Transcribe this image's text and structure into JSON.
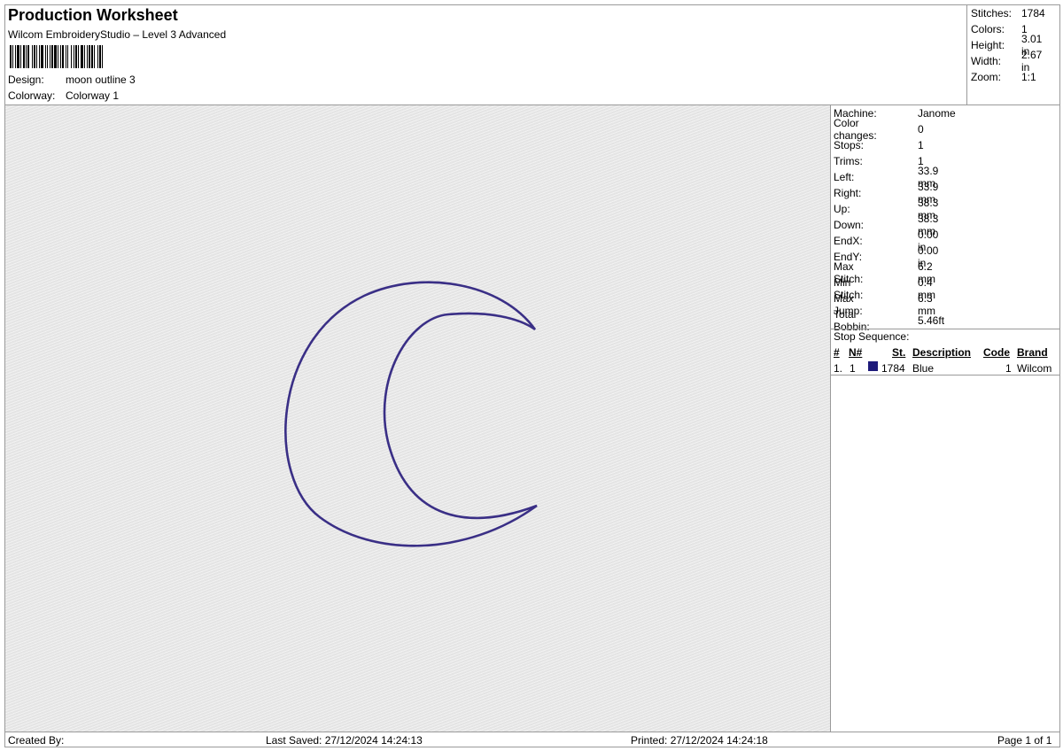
{
  "header": {
    "title": "Production Worksheet",
    "subtitle": "Wilcom EmbroideryStudio – Level 3 Advanced",
    "design_label": "Design:",
    "design_value": "moon outline 3",
    "colorway_label": "Colorway:",
    "colorway_value": "Colorway 1"
  },
  "stats": {
    "stitches_label": "Stitches:",
    "stitches_value": "1784",
    "colors_label": "Colors:",
    "colors_value": "1",
    "height_label": "Height:",
    "height_value": "3.01 in",
    "width_label": "Width:",
    "width_value": "2.67 in",
    "zoom_label": "Zoom:",
    "zoom_value": "1:1"
  },
  "machine_info": [
    {
      "label": "Machine:",
      "value": "Janome"
    },
    {
      "label": "Color changes:",
      "value": "0"
    },
    {
      "label": "Stops:",
      "value": "1"
    },
    {
      "label": "Trims:",
      "value": "1"
    },
    {
      "label": "Left:",
      "value": "33.9 mm"
    },
    {
      "label": "Right:",
      "value": "33.9 mm"
    },
    {
      "label": "Up:",
      "value": "38.3 mm"
    },
    {
      "label": "Down:",
      "value": "38.3 mm"
    },
    {
      "label": "EndX:",
      "value": "0.00 in"
    },
    {
      "label": "EndY:",
      "value": "0.00 in"
    },
    {
      "label": "Max Stitch:",
      "value": "6.2 mm"
    },
    {
      "label": "Min Stitch:",
      "value": "0.4 mm"
    },
    {
      "label": "Max Jump:",
      "value": "6.3 mm"
    },
    {
      "label": "Total Bobbin:",
      "value": "5.46ft"
    }
  ],
  "stop_sequence": {
    "label": "Stop Sequence:",
    "headers": {
      "num": "#",
      "n_num": "N#",
      "st": "St.",
      "description": "Description",
      "code": "Code",
      "brand": "Brand"
    },
    "rows": [
      {
        "num": "1.",
        "n_num": "1",
        "color": "#1e1a7a",
        "st": "1784",
        "description": "Blue",
        "code": "1",
        "brand": "Wilcom"
      }
    ]
  },
  "design_preview": {
    "thread_color": "#3a2f86",
    "background_color": "#ebebeb"
  },
  "footer": {
    "created_by": "Created By:",
    "last_saved": "Last Saved: 27/12/2024 14:24:13",
    "printed": "Printed: 27/12/2024 14:24:18",
    "page": "Page 1 of 1"
  }
}
